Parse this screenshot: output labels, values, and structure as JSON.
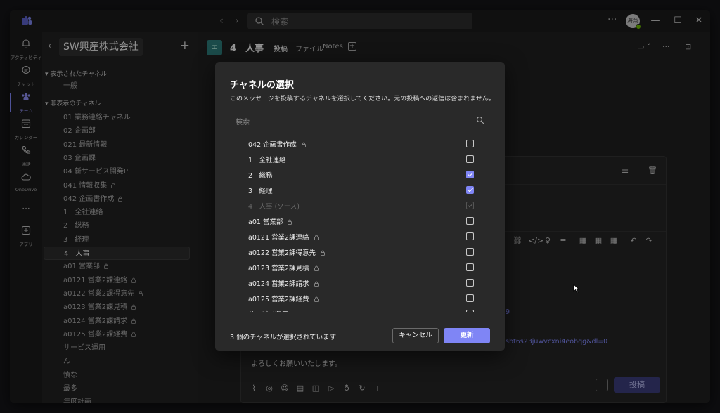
{
  "titlebar": {
    "search_placeholder": "検索",
    "avatar_initials": "海翔",
    "more": "···"
  },
  "rail": {
    "items": [
      {
        "label": "アクティビティ",
        "icon": "bell-icon"
      },
      {
        "label": "チャット",
        "icon": "chat-icon"
      },
      {
        "label": "チーム",
        "icon": "teams-icon"
      },
      {
        "label": "カレンダー",
        "icon": "calendar-icon"
      },
      {
        "label": "通話",
        "icon": "phone-icon"
      },
      {
        "label": "OneDrive",
        "icon": "cloud-icon"
      },
      {
        "label": "アプリ",
        "icon": "apps-icon"
      }
    ],
    "more": "···",
    "active_index": 2
  },
  "channels": {
    "team_name": "SW興産株式会社",
    "shown_section": "表示されたチャネル",
    "hidden_section": "非表示のチャネル",
    "shown": [
      {
        "label": "一般",
        "private": false
      }
    ],
    "hidden": [
      {
        "label": "01 業務連絡チャネル",
        "private": false
      },
      {
        "label": "02 企画部",
        "private": false
      },
      {
        "label": "021 最新情報",
        "private": false
      },
      {
        "label": "03 企画課",
        "private": false
      },
      {
        "label": "04 新サービス開発P",
        "private": false
      },
      {
        "label": "041 情報収集",
        "private": true
      },
      {
        "label": "042 企画書作成",
        "private": true
      },
      {
        "label": "1　全社連絡",
        "private": false
      },
      {
        "label": "2　総務",
        "private": false
      },
      {
        "label": "3　経理",
        "private": false
      },
      {
        "label": "4　人事",
        "private": false,
        "active": true
      },
      {
        "label": "a01 営業部",
        "private": true
      },
      {
        "label": "a0121 営業2課連絡",
        "private": true
      },
      {
        "label": "a0122 営業2課得意先",
        "private": true
      },
      {
        "label": "a0123 営業2課見積",
        "private": true
      },
      {
        "label": "a0124 営業2課請求",
        "private": true
      },
      {
        "label": "a0125 営業2課経費",
        "private": true
      },
      {
        "label": "サービス運用",
        "private": false
      },
      {
        "label": "ん",
        "private": false
      },
      {
        "label": "慎な",
        "private": false
      },
      {
        "label": "最多",
        "private": false
      },
      {
        "label": "年度計画",
        "private": false
      }
    ]
  },
  "main": {
    "team_badge": "エ",
    "channel_title": "4　人事",
    "tabs": [
      "投稿",
      "ファイル",
      "Notes"
    ],
    "compose": {
      "link_line_1": "9",
      "link_line_2": "sbt6s23juwvcxni4eobqg&dl=0",
      "body": "よろしくお願いいたします。",
      "send_label": "投稿"
    }
  },
  "dialog": {
    "title": "チャネルの選択",
    "description": "このメッセージを投稿するチャネルを選択してください。元の投稿への返信は含まれません。",
    "search_placeholder": "検索",
    "rows": [
      {
        "label": "042 企画書作成",
        "private": true,
        "checked": false,
        "disabled": false
      },
      {
        "label": "1　全社連絡",
        "private": false,
        "checked": false,
        "disabled": false
      },
      {
        "label": "2　総務",
        "private": false,
        "checked": true,
        "disabled": false
      },
      {
        "label": "3　経理",
        "private": false,
        "checked": true,
        "disabled": false
      },
      {
        "label": "4　人事 (ソース)",
        "private": false,
        "checked": true,
        "disabled": true
      },
      {
        "label": "a01 営業部",
        "private": true,
        "checked": false,
        "disabled": false
      },
      {
        "label": "a0121 営業2課連絡",
        "private": true,
        "checked": false,
        "disabled": false
      },
      {
        "label": "a0122 営業2課得意先",
        "private": true,
        "checked": false,
        "disabled": false
      },
      {
        "label": "a0123 営業2課見積",
        "private": true,
        "checked": false,
        "disabled": false
      },
      {
        "label": "a0124 営業2課請求",
        "private": true,
        "checked": false,
        "disabled": false
      },
      {
        "label": "a0125 営業2課経費",
        "private": true,
        "checked": false,
        "disabled": false
      },
      {
        "label": "サービス運用",
        "private": false,
        "checked": false,
        "disabled": false
      }
    ],
    "selected_count_text": "3 個のチャネルが選択されています",
    "cancel_label": "キャンセル",
    "update_label": "更新"
  },
  "colors": {
    "accent": "#7f85f5",
    "team_badge": "#2c7a78",
    "background": "#1f1f1f",
    "dialog": "#292929"
  }
}
